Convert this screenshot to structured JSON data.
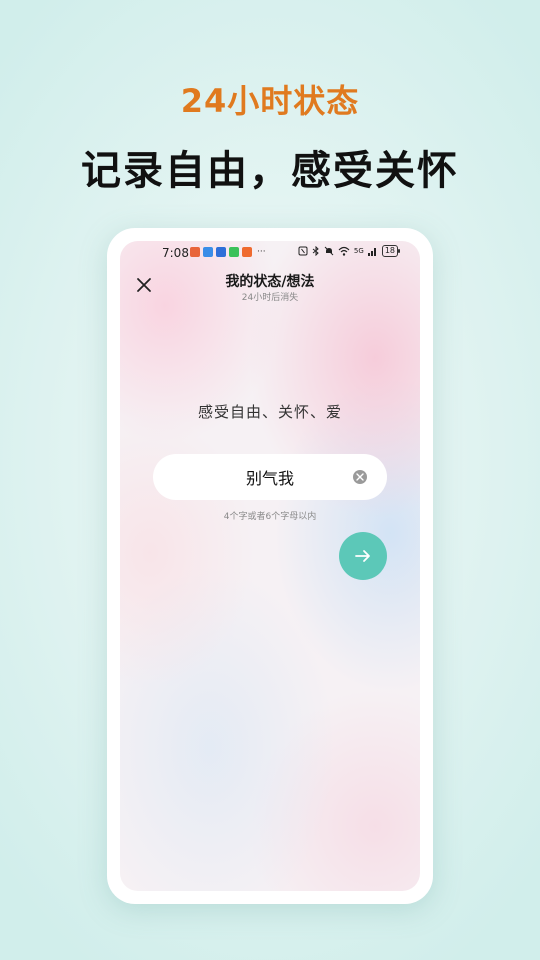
{
  "promo": {
    "subtitle": "24小时状态",
    "title": "记录自由，感受关怀"
  },
  "status_bar": {
    "time": "7:08",
    "notification_icons": [
      "app-icon-orange",
      "app-icon-blue",
      "app-icon-blue-2",
      "app-icon-green",
      "app-icon-orange-2"
    ],
    "more": "···",
    "system_icons": [
      "nfc-icon",
      "bluetooth-icon",
      "mute-icon",
      "wifi-icon",
      "signal-icon"
    ],
    "network": "5G",
    "battery": "18"
  },
  "header": {
    "title": "我的状态/想法",
    "subtitle": "24小时后消失"
  },
  "main": {
    "slogan": "感受自由、关怀、爱",
    "input_value": "别气我",
    "hint": "4个字或者6个字母以内"
  },
  "colors": {
    "accent": "#5cc8b8",
    "promo_orange": "#e07a1f",
    "background": "#d1eeeb"
  }
}
